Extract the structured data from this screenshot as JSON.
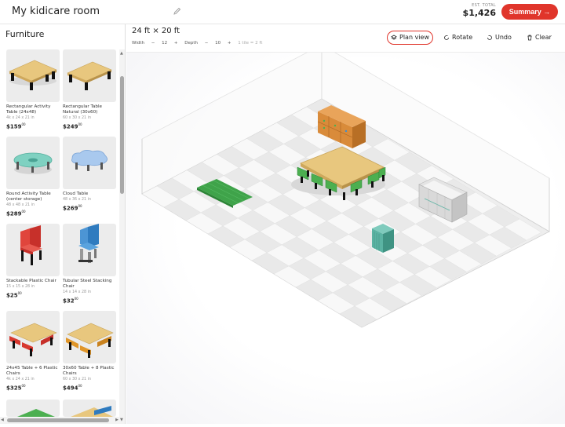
{
  "header": {
    "room_title": "My kidicare room",
    "est_label": "EST. TOTAL",
    "est_total": "$1,426",
    "summary_label": "Summary →"
  },
  "sidebar": {
    "title": "Furniture",
    "items": [
      {
        "name": "Rectangular Activity Table (24x48)",
        "dims": "4k x 24 x 21 in",
        "price": "$159",
        "cents": "00",
        "icon": "rect-table-icon"
      },
      {
        "name": "Rectangular Table Natural (30x60)",
        "dims": "60 x 30 x 21 in",
        "price": "$249",
        "cents": "00",
        "icon": "rect-table-icon"
      },
      {
        "name": "Round Activity Table (center storage)",
        "dims": "48 x 48 x 21 in",
        "price": "$289",
        "cents": "00",
        "icon": "round-table-icon"
      },
      {
        "name": "Cloud Table",
        "dims": "48 x 36 x 21 in",
        "price": "$269",
        "cents": "00",
        "icon": "cloud-table-icon"
      },
      {
        "name": "Stackable Plastic Chair",
        "dims": "15 x 15 x 28 in",
        "price": "$25",
        "cents": "00",
        "icon": "red-chair-icon"
      },
      {
        "name": "Tubular Steel Stacking Chair",
        "dims": "14 x 14 x 28 in",
        "price": "$32",
        "cents": "00",
        "icon": "blue-chair-icon"
      },
      {
        "name": "24x45 Table + 6 Plastic Chairs",
        "dims": "4k x 24 x 21 in",
        "price": "$325",
        "cents": "00",
        "icon": "table-set-red-icon"
      },
      {
        "name": "30x60 Table + 8 Plastic Chairs",
        "dims": "60 x 30 x 21 in",
        "price": "$494",
        "cents": "00",
        "icon": "table-set-orange-icon"
      }
    ]
  },
  "toolbar": {
    "dimensions_title": "24 ft × 20 ft",
    "width_label": "Width",
    "width_minus": "−",
    "width_value": "12",
    "width_plus": "+",
    "depth_label": "Depth",
    "depth_minus": "−",
    "depth_value": "10",
    "depth_plus": "+",
    "tile_note": "1 tile = 2 ft",
    "plan_view": "Plan view",
    "rotate": "Rotate",
    "undo": "Undo",
    "clear": "Clear"
  },
  "colors": {
    "accent": "#e0352b",
    "table_top": "#e8c77e",
    "chair_green": "#4caf50",
    "shelf_orange": "#d98b3a",
    "cabinet_teal": "#5bb3a3"
  }
}
